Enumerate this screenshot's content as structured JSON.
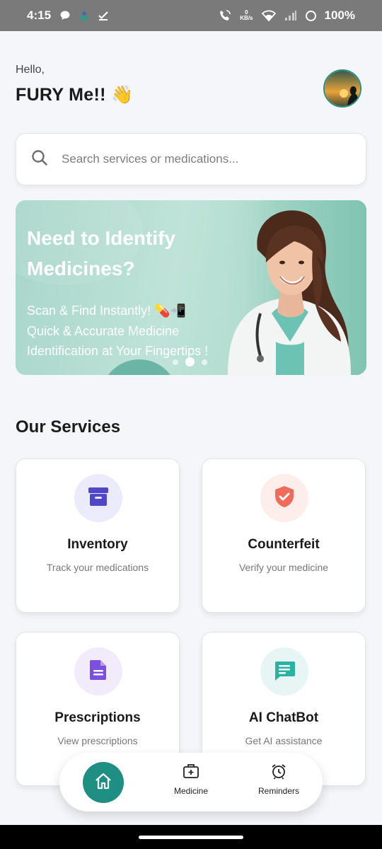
{
  "status_bar": {
    "time": "4:15",
    "net_speed_value": "0",
    "net_speed_unit": "KB/s",
    "battery": "100%"
  },
  "greeting": {
    "hello": "Hello,",
    "name": "FURY Me!! 👋"
  },
  "search": {
    "placeholder": "Search services or medications..."
  },
  "banner": {
    "title": "Need to Identify Medicines?",
    "subtitle_line1": "Scan & Find Instantly! 💊📲",
    "subtitle_line2": "Quick & Accurate Medicine Identification at Your Fingertips !",
    "dots_count": 3,
    "active_dot": 1
  },
  "services": {
    "title": "Our Services",
    "items": [
      {
        "title": "Inventory",
        "subtitle": "Track your medications",
        "icon": "archive-box-icon",
        "color": "#4f46c8",
        "bg": "#ecebfb"
      },
      {
        "title": "Counterfeit",
        "subtitle": "Verify your medicine",
        "icon": "shield-check-icon",
        "color": "#f26a5a",
        "bg": "#fdeeeb"
      },
      {
        "title": "Prescriptions",
        "subtitle": "View prescriptions",
        "icon": "document-icon",
        "color": "#7c4fe0",
        "bg": "#f1ebfc"
      },
      {
        "title": "AI ChatBot",
        "subtitle": "Get AI assistance",
        "icon": "chat-icon",
        "color": "#2ab3a3",
        "bg": "#e7f6f4"
      }
    ]
  },
  "bottom_nav": {
    "home_icon": "home-icon",
    "medicine_label": "Medicine",
    "reminders_label": "Reminders"
  },
  "colors": {
    "accent": "#1f8f84",
    "background": "#f5f6f9"
  }
}
